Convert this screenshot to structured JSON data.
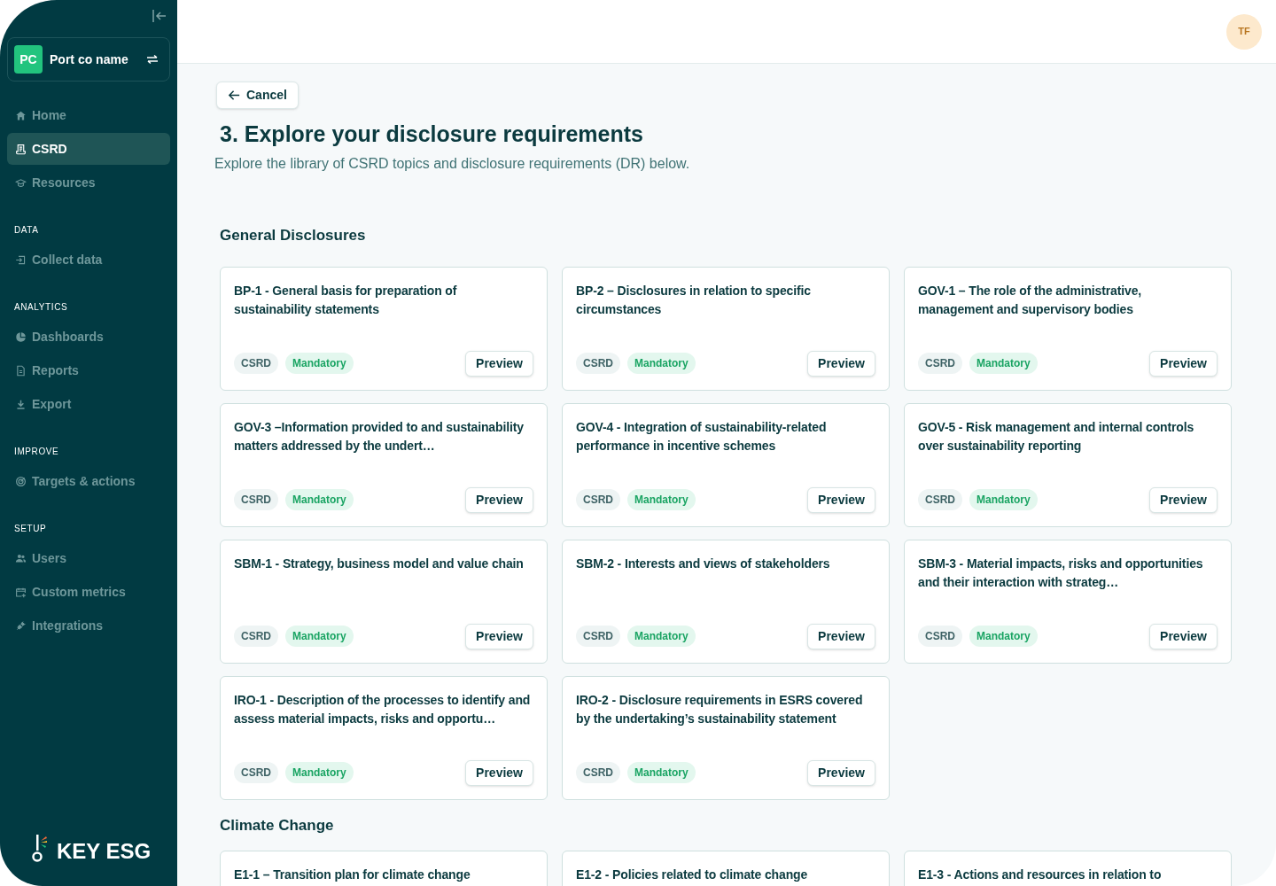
{
  "sidebar": {
    "workspace": {
      "initials": "PC",
      "name": "Port co name"
    },
    "sections": [
      {
        "items": [
          {
            "label": "Home",
            "selected": false
          },
          {
            "label": "CSRD",
            "selected": true
          },
          {
            "label": "Resources",
            "selected": false
          }
        ]
      },
      {
        "heading": "DATA",
        "items": [
          {
            "label": "Collect data",
            "selected": false
          }
        ]
      },
      {
        "heading": "ANALYTICS",
        "items": [
          {
            "label": "Dashboards",
            "selected": false
          },
          {
            "label": "Reports",
            "selected": false
          },
          {
            "label": "Export",
            "selected": false
          }
        ]
      },
      {
        "heading": "IMPROVE",
        "items": [
          {
            "label": "Targets & actions",
            "selected": false
          }
        ]
      },
      {
        "heading": "SETUP",
        "items": [
          {
            "label": "Users",
            "selected": false
          },
          {
            "label": "Custom metrics",
            "selected": false
          },
          {
            "label": "Integrations",
            "selected": false
          }
        ]
      }
    ],
    "logo": "KEY ESG"
  },
  "header": {
    "avatar": "TF"
  },
  "page": {
    "back_button": "Cancel",
    "title": "3. Explore your disclosure requirements",
    "subtitle": "Explore the library of CSRD topics and disclosure requirements (DR) below.",
    "groups": [
      {
        "heading": "General Disclosures",
        "cards": [
          {
            "title": "BP-1 - General basis for preparation of sustainability statements",
            "tags": [
              {
                "label": "CSRD",
                "kind": "framework"
              },
              {
                "label": "Mandatory",
                "kind": "mandatory"
              }
            ],
            "action": "Preview"
          },
          {
            "title": "BP-2 – Disclosures in relation to specific circumstances",
            "tags": [
              {
                "label": "CSRD",
                "kind": "framework"
              },
              {
                "label": "Mandatory",
                "kind": "mandatory"
              }
            ],
            "action": "Preview"
          },
          {
            "title": "GOV-1 – The role of the administrative, management and supervisory bodies",
            "tags": [
              {
                "label": "CSRD",
                "kind": "framework"
              },
              {
                "label": "Mandatory",
                "kind": "mandatory"
              }
            ],
            "action": "Preview"
          },
          {
            "title": "GOV-3 –Information provided to and sustainability matters addressed by the undert…",
            "tags": [
              {
                "label": "CSRD",
                "kind": "framework"
              },
              {
                "label": "Mandatory",
                "kind": "mandatory"
              }
            ],
            "action": "Preview"
          },
          {
            "title": "GOV-4 - Integration of sustainability-related performance in incentive schemes",
            "tags": [
              {
                "label": "CSRD",
                "kind": "framework"
              },
              {
                "label": "Mandatory",
                "kind": "mandatory"
              }
            ],
            "action": "Preview"
          },
          {
            "title": "GOV-5 - Risk management and internal controls over sustainability reporting",
            "tags": [
              {
                "label": "CSRD",
                "kind": "framework"
              },
              {
                "label": "Mandatory",
                "kind": "mandatory"
              }
            ],
            "action": "Preview"
          },
          {
            "title": "SBM-1 - Strategy, business model and value chain",
            "tags": [
              {
                "label": "CSRD",
                "kind": "framework"
              },
              {
                "label": "Mandatory",
                "kind": "mandatory"
              }
            ],
            "action": "Preview"
          },
          {
            "title": "SBM-2 - Interests and views of stakeholders",
            "tags": [
              {
                "label": "CSRD",
                "kind": "framework"
              },
              {
                "label": "Mandatory",
                "kind": "mandatory"
              }
            ],
            "action": "Preview"
          },
          {
            "title": "SBM-3 - Material impacts, risks and opportunities and their interaction with strateg…",
            "tags": [
              {
                "label": "CSRD",
                "kind": "framework"
              },
              {
                "label": "Mandatory",
                "kind": "mandatory"
              }
            ],
            "action": "Preview"
          },
          {
            "title": "IRO-1 - Description of the processes to identify and assess material impacts, risks and opportu…",
            "tags": [
              {
                "label": "CSRD",
                "kind": "framework"
              },
              {
                "label": "Mandatory",
                "kind": "mandatory"
              }
            ],
            "action": "Preview"
          },
          {
            "title": "IRO-2 - Disclosure requirements in ESRS covered by the undertaking’s sustainability statement",
            "tags": [
              {
                "label": "CSRD",
                "kind": "framework"
              },
              {
                "label": "Mandatory",
                "kind": "mandatory"
              }
            ],
            "action": "Preview"
          }
        ]
      },
      {
        "heading": "Climate Change",
        "cards": [
          {
            "title": "E1-1 – Transition plan for climate change"
          },
          {
            "title": "E1-2 - Policies related to climate change"
          },
          {
            "title": "E1-3 - Actions and resources in relation to"
          }
        ]
      }
    ]
  }
}
